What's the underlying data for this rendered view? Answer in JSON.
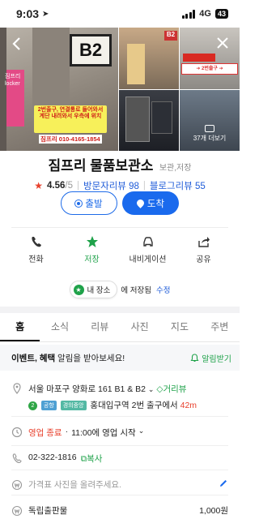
{
  "status_bar": {
    "time": "9:03",
    "network": "4G",
    "battery": "43"
  },
  "photos": {
    "b2_sign": "B2",
    "locker_text": "짐프리 locker",
    "main_caption": "2번출구, 연결통로 들어와서 계단 내려와서 우측에 위치",
    "phone_label": "짐프리 010-4165-1854",
    "more_label": "37개 더보기"
  },
  "place": {
    "name": "짐프리 물품보관소",
    "category": "보관,저장",
    "rating": "4.56",
    "rating_max": "/5",
    "visitor_reviews": "방문자리뷰 98",
    "blog_reviews": "블로그리뷰 55"
  },
  "cta": {
    "start": "출발",
    "arrive": "도착"
  },
  "actions": [
    {
      "label": "전화"
    },
    {
      "label": "저장"
    },
    {
      "label": "내비게이션"
    },
    {
      "label": "공유"
    }
  ],
  "saved": {
    "chip": "내 장소",
    "text": "에 저장됨",
    "edit": "수정"
  },
  "tabs": [
    "홈",
    "소식",
    "리뷰",
    "사진",
    "지도",
    "주변"
  ],
  "notice": {
    "bold": "이벤트, 혜택",
    "text": " 알림을 받아보세요!",
    "button": "알림받기"
  },
  "address": {
    "text": "서울 마포구 양화로 161 B1 & B2",
    "distance_label": "거리뷰",
    "line_badge": "2",
    "airport_badge": "공항",
    "gyeongui_badge": "경의중앙",
    "station": "홍대입구역 2번 출구에서",
    "distance": "42m"
  },
  "hours": {
    "status": "영업 종료",
    "sep": "·",
    "next": "11:00에 영업 시작"
  },
  "phone": {
    "number": "02-322-1816",
    "copy": "복사"
  },
  "price": {
    "placeholder": "가격표 사진을 올려주세요."
  },
  "menu": {
    "item": "독립출판물",
    "price": "1,000원"
  },
  "colors": {
    "accent_blue": "#1a6aed",
    "accent_green": "#1fa24a",
    "rating_red": "#e8412d"
  }
}
